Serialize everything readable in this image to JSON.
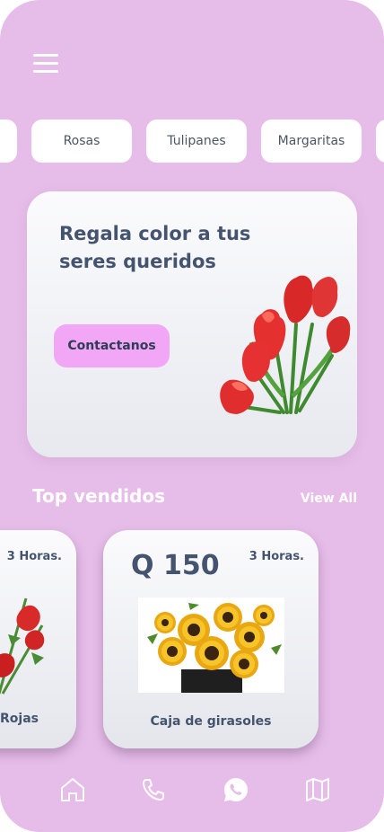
{
  "categories": [
    "Rosas",
    "Tulipanes",
    "Margaritas"
  ],
  "hero": {
    "title": "Regala color a tus seres queridos",
    "cta_label": "Contactanos"
  },
  "section": {
    "title": "Top vendidos",
    "view_all": "View All"
  },
  "products": [
    {
      "time": "3 Horas.",
      "name": "Rojas"
    },
    {
      "price": "Q 150",
      "time": "3 Horas.",
      "name": "Caja de girasoles"
    }
  ],
  "nav": {
    "icons": [
      "home-icon",
      "phone-icon",
      "whatsapp-icon",
      "map-icon"
    ]
  },
  "colors": {
    "background": "#e6bde8",
    "card": "#f4f5f8",
    "accent": "#f2a6f6",
    "text_dark": "#44546f"
  }
}
